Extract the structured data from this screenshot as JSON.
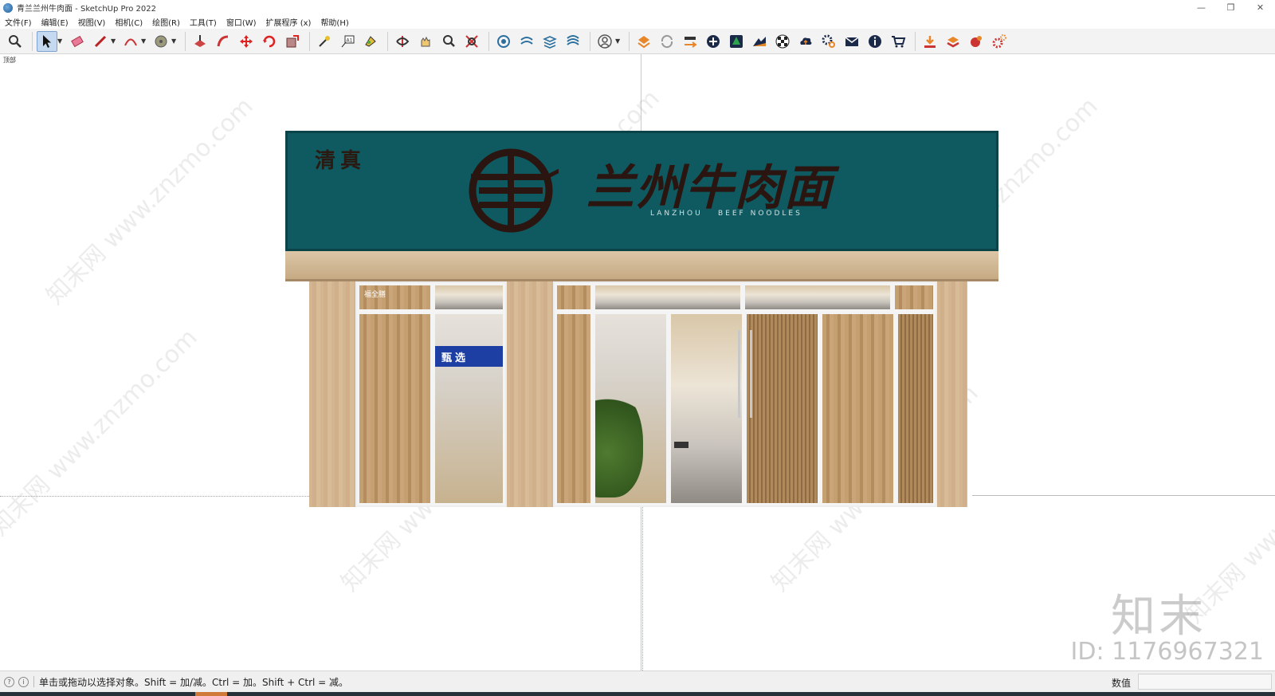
{
  "window": {
    "title": "青兰兰州牛肉面 - SketchUp Pro 2022",
    "minimize": "—",
    "restore": "❐",
    "close": "✕"
  },
  "menu": [
    "文件(F)",
    "编辑(E)",
    "视图(V)",
    "相机(C)",
    "绘图(R)",
    "工具(T)",
    "窗口(W)",
    "扩展程序 (x)",
    "帮助(H)"
  ],
  "toolbar": {
    "groups": [
      [
        "zoom-extents-icon"
      ],
      [
        "select-icon",
        "eraser-icon",
        "pencil-icon",
        "arc-icon",
        "paint-bucket-icon"
      ],
      [
        "push-pull-icon",
        "follow-me-icon",
        "move-icon",
        "rotate-icon",
        "scale-icon"
      ],
      [
        "tape-measure-icon",
        "text-icon",
        "paint-icon"
      ],
      [
        "orbit-icon",
        "pan-icon",
        "zoom-icon",
        "zoom-window-icon"
      ],
      [
        "sandbox-icon",
        "smoove-icon",
        "stamp-icon",
        "drape-icon"
      ],
      [
        "user-icon"
      ],
      [
        "warehouse-icon",
        "refresh-icon",
        "share-icon",
        "add-icon",
        "tree-icon",
        "terrain-icon",
        "checker-icon",
        "cloud-icon",
        "settings-icon",
        "mail-icon",
        "info-icon",
        "cart-icon"
      ],
      [
        "import-icon",
        "export-icon",
        "render-icon",
        "gear-plugin-icon"
      ]
    ],
    "active": "select-icon"
  },
  "viewport": {
    "scene_label": "顶部",
    "sign": {
      "sub": "清真",
      "main": "兰州牛肉面",
      "en_a": "LANZHOU",
      "en_b": "BEEF NOODLES",
      "bg_color": "#0f5a60"
    },
    "interior_sign": "甄选",
    "window_note": "福全膳"
  },
  "watermark": {
    "brand": "知末",
    "id_label": "ID: 1176967321",
    "site": "知末网 www.znzmo.com"
  },
  "status": {
    "hint": "单击或拖动以选择对象。Shift = 加/减。Ctrl = 加。Shift + Ctrl = 减。",
    "measure_label": "数值",
    "measure_value": ""
  }
}
